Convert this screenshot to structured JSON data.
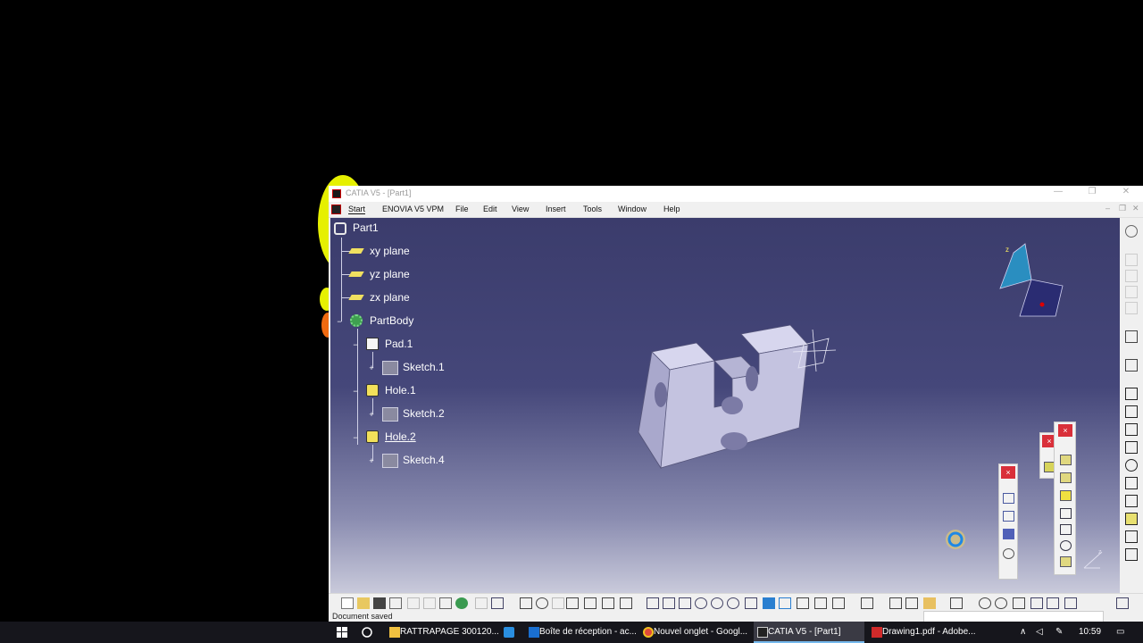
{
  "window": {
    "title": "CATIA V5 - [Part1]",
    "controls": {
      "minimize": "—",
      "restore": "❐",
      "close": "✕"
    }
  },
  "menu": {
    "items": [
      "Start",
      "ENOVIA V5 VPM",
      "File",
      "Edit",
      "View",
      "Insert",
      "Tools",
      "Window",
      "Help"
    ],
    "mdi_controls": [
      "–",
      "❐",
      "✕"
    ]
  },
  "tree": {
    "root": "Part1",
    "nodes": [
      {
        "label": "xy plane",
        "icon": "plane-icon"
      },
      {
        "label": "yz plane",
        "icon": "plane-icon"
      },
      {
        "label": "zx plane",
        "icon": "plane-icon"
      },
      {
        "label": "PartBody",
        "icon": "body-icon"
      },
      {
        "label": "Pad.1",
        "icon": "pad-icon"
      },
      {
        "label": "Sketch.1",
        "icon": "sketch-icon"
      },
      {
        "label": "Hole.1",
        "icon": "hole-icon"
      },
      {
        "label": "Sketch.2",
        "icon": "sketch-icon"
      },
      {
        "label": "Hole.2",
        "icon": "hole-icon"
      },
      {
        "label": "Sketch.4",
        "icon": "sketch-icon"
      }
    ]
  },
  "compass": {
    "axis_label": "z"
  },
  "axis_triad": {
    "label": "z"
  },
  "status": {
    "text": "Document saved"
  },
  "colors": {
    "viewport_top": "#3b3c6c",
    "viewport_bottom": "#c9cadb",
    "part_face": "#c4c3e0",
    "close_red": "#d9303a",
    "taskbar_bg": "#16161c"
  },
  "taskbar": {
    "items": [
      {
        "label": "RATTRAPAGE 300120...",
        "icon": "folder-icon"
      },
      {
        "label": "Boîte de réception - ac...",
        "icon": "outlook-icon"
      },
      {
        "label": "Nouvel onglet - Googl...",
        "icon": "chrome-icon"
      },
      {
        "label": "CATIA V5 - [Part1]",
        "icon": "catia-icon"
      },
      {
        "label": "Drawing1.pdf - Adobe...",
        "icon": "pdf-icon"
      }
    ],
    "clock": "10:59"
  }
}
